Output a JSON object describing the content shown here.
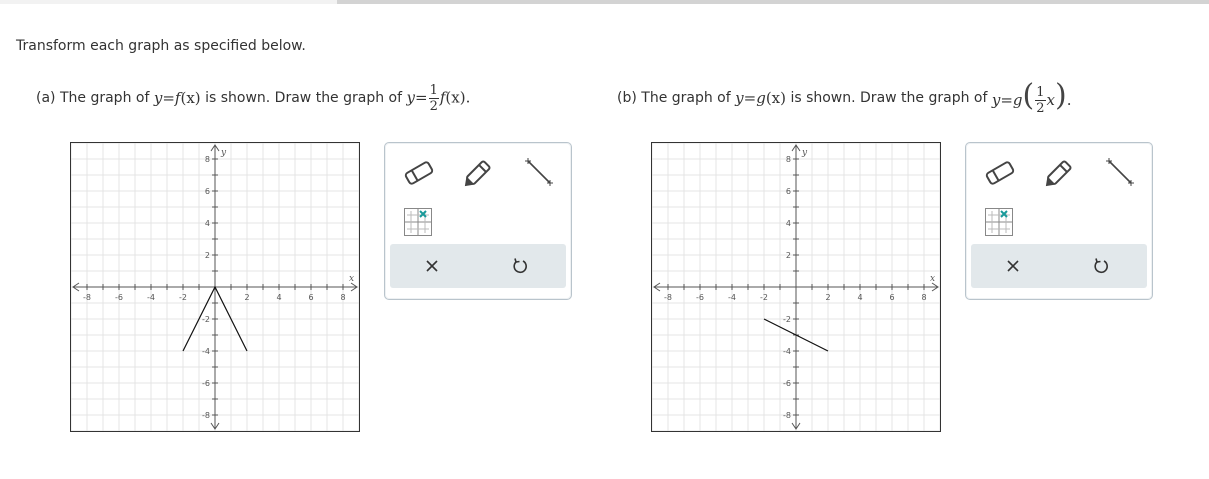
{
  "instruction": "Transform each graph as specified below.",
  "part_a": {
    "label": "(a)",
    "text1": "The graph of",
    "eq1_y": "y",
    "eq1_eq": "=",
    "eq1_f": "f",
    "eq1_arg": "(x)",
    "text2": "is shown. Draw the graph of",
    "eq2_y": "y",
    "eq2_eq": "=",
    "eq2_num": "1",
    "eq2_den": "2",
    "eq2_f": "f",
    "eq2_arg": "(x).",
    "graph": {
      "x_ticks": [
        "-8",
        "-6",
        "-4",
        "-2",
        "2",
        "4",
        "6",
        "8"
      ],
      "y_ticks": [
        "8",
        "6",
        "4",
        "2",
        "-2",
        "-4",
        "-6",
        "-8"
      ],
      "x_axis_label": "x",
      "y_axis_label": "y",
      "curve": [
        [
          -2,
          -4
        ],
        [
          0,
          0
        ],
        [
          2,
          -4
        ]
      ]
    }
  },
  "part_b": {
    "label": "(b)",
    "text1": "The graph of",
    "eq1_y": "y",
    "eq1_eq": "=",
    "eq1_g": "g",
    "eq1_arg": "(x)",
    "text2": "is shown. Draw the graph of",
    "eq2_y": "y",
    "eq2_eq": "=",
    "eq2_g": "g",
    "eq2_num": "1",
    "eq2_den": "2",
    "eq2_x": "x",
    "eq2_end": ".",
    "graph": {
      "x_ticks": [
        "-8",
        "-6",
        "-4",
        "-2",
        "2",
        "4",
        "6",
        "8"
      ],
      "y_ticks": [
        "8",
        "6",
        "4",
        "2",
        "-2",
        "-4",
        "-6",
        "-8"
      ],
      "x_axis_label": "x",
      "y_axis_label": "y",
      "curve": [
        [
          -2,
          -2
        ],
        [
          2,
          -4
        ]
      ]
    }
  },
  "tools": {
    "eraser": "eraser-icon",
    "pencil": "pencil-icon",
    "line": "line-segment-icon",
    "graph_settings": "graph-settings-icon",
    "clear": "clear-icon",
    "undo": "undo-icon",
    "accent_color": "#1a9a9a"
  }
}
